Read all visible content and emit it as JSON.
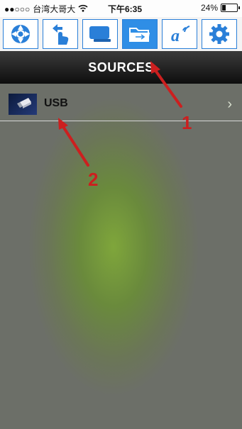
{
  "status_bar": {
    "signal": "●●○○○",
    "carrier": "台湾大哥大",
    "time": "下午6:35",
    "battery": "24%",
    "battery_level": 0.24
  },
  "toolbar": {
    "tabs": [
      {
        "icon": "lifebuoy-icon"
      },
      {
        "icon": "touch-icon"
      },
      {
        "icon": "screen-icon"
      },
      {
        "icon": "folder-usb-icon",
        "active": true
      },
      {
        "icon": "wireless-a-icon"
      },
      {
        "icon": "gear-icon"
      }
    ]
  },
  "header": {
    "title": "SOURCES"
  },
  "sources": [
    {
      "label": "USB",
      "icon": "usb-thumbnail-icon"
    }
  ],
  "annotations": {
    "a1": "1",
    "a2": "2",
    "color": "#cc1f1f"
  },
  "colors": {
    "accent": "#2f8ee6",
    "header_bg": "#1a1a1a"
  }
}
